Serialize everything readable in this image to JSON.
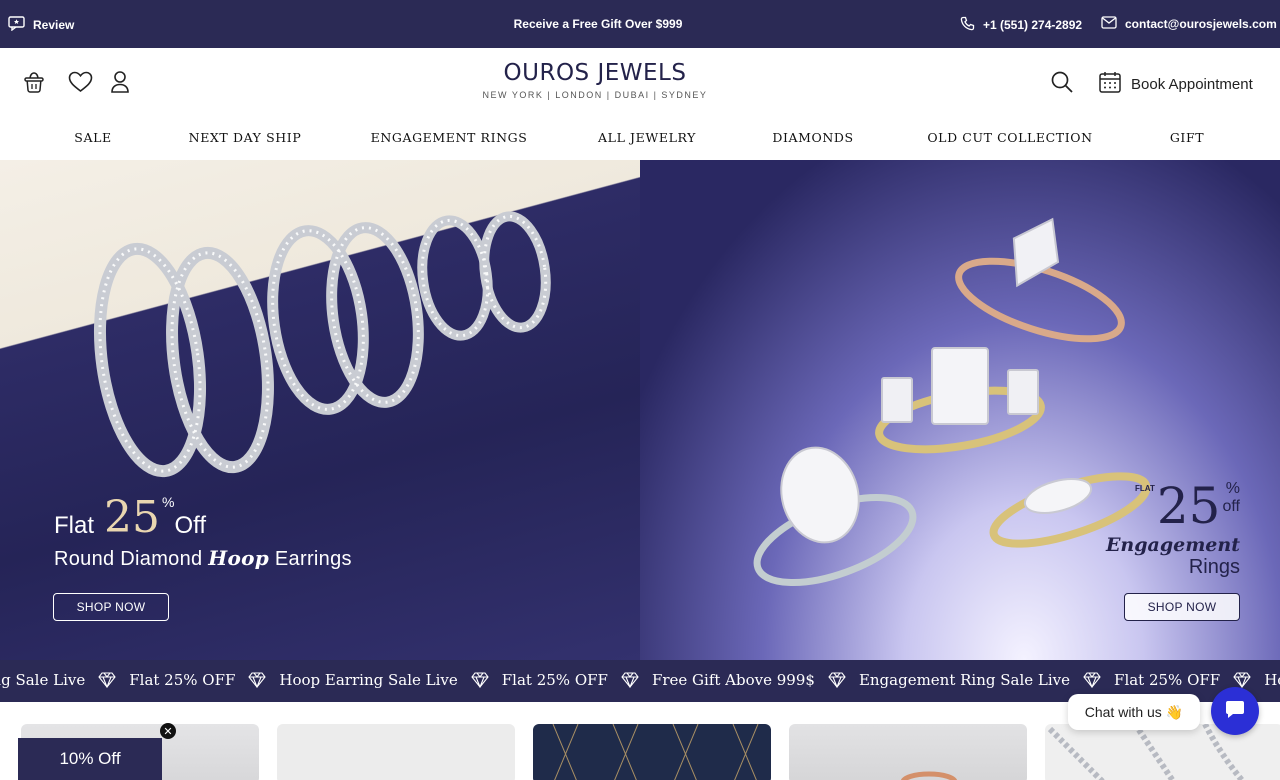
{
  "topbar": {
    "review_label": "Review",
    "promo_text": "Receive a Free Gift Over $999",
    "phone": "+1 (551) 274-2892",
    "email": "contact@ourosjewels.com"
  },
  "header": {
    "logo_title": "OUROS JEWELS",
    "logo_subtitle": "NEW YORK | LONDON | DUBAI | SYDNEY",
    "appointment_label": "Book Appointment"
  },
  "nav": {
    "items": [
      {
        "label": "SALE"
      },
      {
        "label": "NEXT DAY SHIP"
      },
      {
        "label": "ENGAGEMENT RINGS"
      },
      {
        "label": "ALL JEWELRY"
      },
      {
        "label": "DIAMONDS"
      },
      {
        "label": "OLD CUT COLLECTION"
      },
      {
        "label": "GIFT"
      }
    ]
  },
  "hero": {
    "left": {
      "flat": "Flat",
      "number": "25",
      "percent": "%",
      "off": "Off",
      "subtitle_pre": "Round Diamond",
      "subtitle_emph": "Hoop",
      "subtitle_post": "Earrings",
      "button": "SHOP NOW"
    },
    "right": {
      "flat": "FLAT",
      "number": "25",
      "percent": "%",
      "off": "off",
      "subtitle_emph": "Engagement",
      "subtitle_post": "Rings",
      "button": "SHOP NOW"
    }
  },
  "marquee": {
    "items": [
      "ent Ring Sale Live",
      "Flat 25% OFF",
      "Hoop Earring Sale Live",
      "Flat 25% OFF",
      "Free Gift Above 999$",
      "Engagement Ring Sale Live",
      "Flat 25% OFF",
      "Hoop E"
    ]
  },
  "discount": {
    "label": "10% Off",
    "close": "✕"
  },
  "chat": {
    "label": "Chat with us",
    "emoji": "👋"
  },
  "colors": {
    "brand_navy": "#2b2a55",
    "chat_blue": "#2b2fd6"
  }
}
